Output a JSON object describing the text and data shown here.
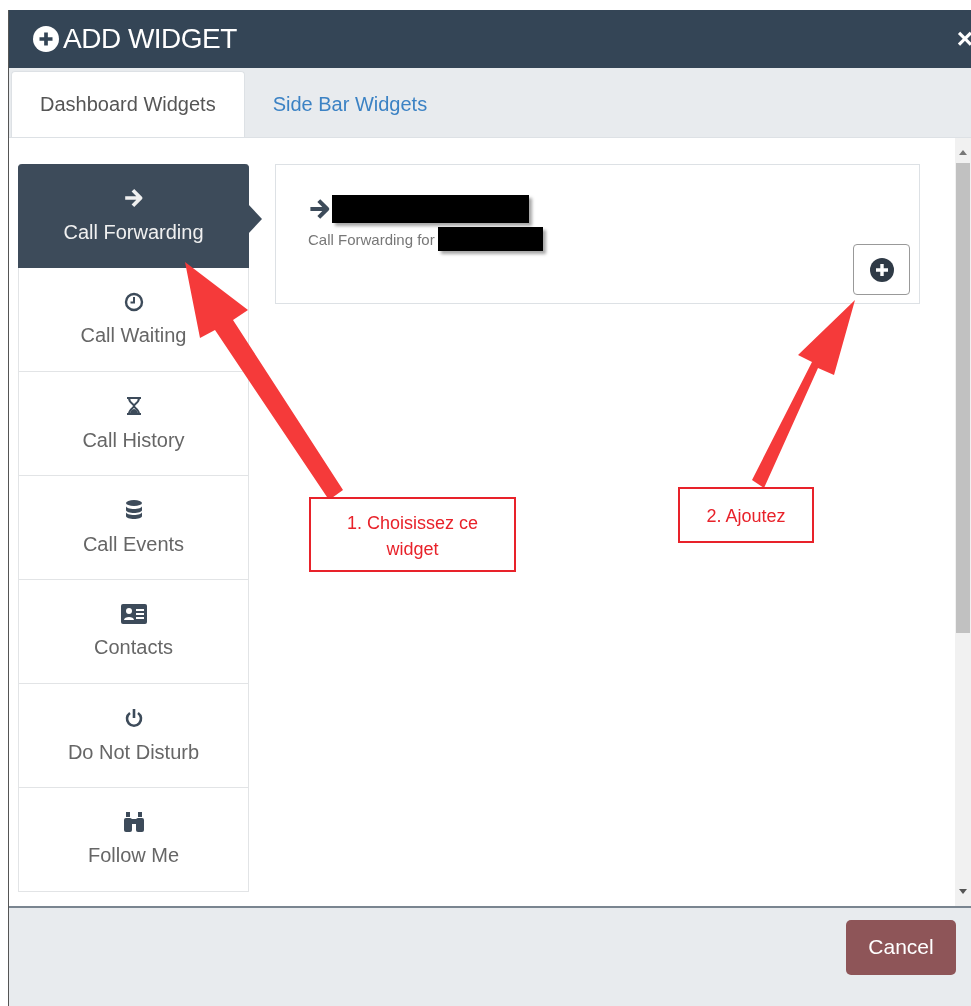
{
  "window": {
    "title": "ADD WIDGET",
    "close": "×"
  },
  "tabs": [
    {
      "label": "Dashboard Widgets",
      "selected": true
    },
    {
      "label": "Side Bar Widgets",
      "selected": false
    }
  ],
  "widgets": [
    {
      "label": "Call Forwarding",
      "selected": true
    },
    {
      "label": "Call Waiting",
      "selected": false
    },
    {
      "label": "Call History",
      "selected": false
    },
    {
      "label": "Call Events",
      "selected": false
    },
    {
      "label": "Contacts",
      "selected": false
    },
    {
      "label": "Do Not Disturb",
      "selected": false
    },
    {
      "label": "Follow Me",
      "selected": false
    }
  ],
  "card": {
    "subtitle": "Call Forwarding for"
  },
  "annotations": [
    {
      "text": "1. Choisissez ce widget"
    },
    {
      "text": "2. Ajoutez"
    }
  ],
  "footer": {
    "cancel": "Cancel"
  }
}
